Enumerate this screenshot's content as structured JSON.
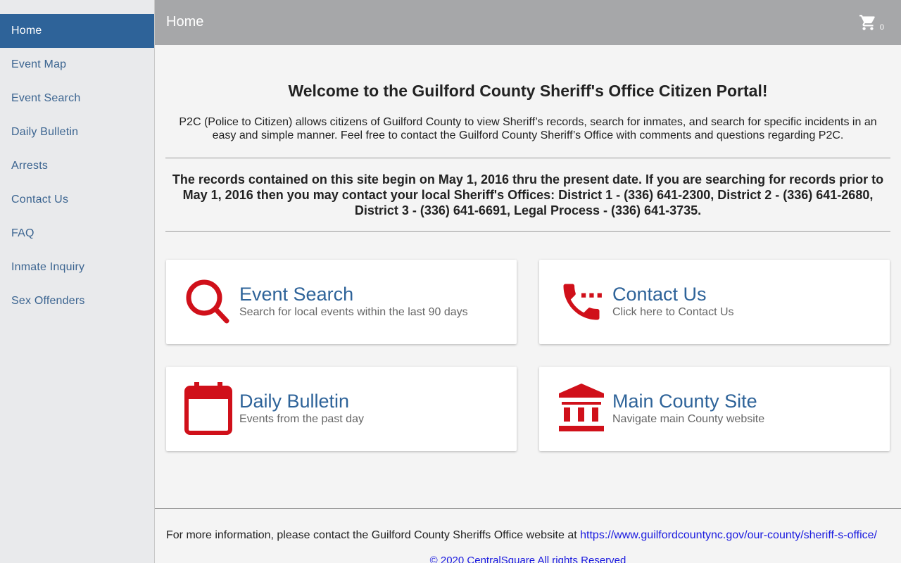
{
  "sidebar": {
    "items": [
      {
        "label": "Home"
      },
      {
        "label": "Event Map"
      },
      {
        "label": "Event Search"
      },
      {
        "label": "Daily Bulletin"
      },
      {
        "label": "Arrests"
      },
      {
        "label": "Contact Us"
      },
      {
        "label": "FAQ"
      },
      {
        "label": "Inmate Inquiry"
      },
      {
        "label": "Sex Offenders"
      }
    ]
  },
  "header": {
    "title": "Home",
    "cart_count": "0",
    "cart_icon": "shopping-cart-icon"
  },
  "main": {
    "welcome": "Welcome to the Guilford County Sheriff's Office Citizen Portal!",
    "intro": "P2C (Police to Citizen) allows citizens of Guilford County to view Sheriff’s records, search for inmates, and search for specific incidents in an easy and simple manner. Feel free to contact the Guilford County Sheriff’s Office with comments and questions regarding P2C.",
    "records_notice": "The records contained on this site begin on May 1, 2016 thru the present date. If you are searching for records prior to May 1, 2016 then you may contact your local Sheriff's Offices: District 1 - (336) 641-2300, District 2 - (336) 641-2680, District 3 - (336) 641-6691, Legal Process - (336) 641-3735.",
    "cards": [
      {
        "title": "Event Search",
        "subtitle": "Search for local events within the last 90 days",
        "icon": "search-icon"
      },
      {
        "title": "Contact Us",
        "subtitle": "Click here to Contact Us",
        "icon": "phone-icon"
      },
      {
        "title": "Daily Bulletin",
        "subtitle": "Events from the past day",
        "icon": "calendar-icon"
      },
      {
        "title": "Main County Site",
        "subtitle": "Navigate main County website",
        "icon": "bank-icon"
      }
    ]
  },
  "footer": {
    "text": "For more information, please contact the Guilford County Sheriffs Office website at",
    "link": "https://www.guilfordcountync.gov/our-county/sheriff-s-office/",
    "copyright": "© 2020 CentralSquare All rights Reserved"
  },
  "colors": {
    "accent": "#2e6399",
    "icon_red": "#d0101a",
    "topbar": "#a6a7a9",
    "sidebar_bg": "#e9eaec",
    "link": "#1a1adf"
  }
}
